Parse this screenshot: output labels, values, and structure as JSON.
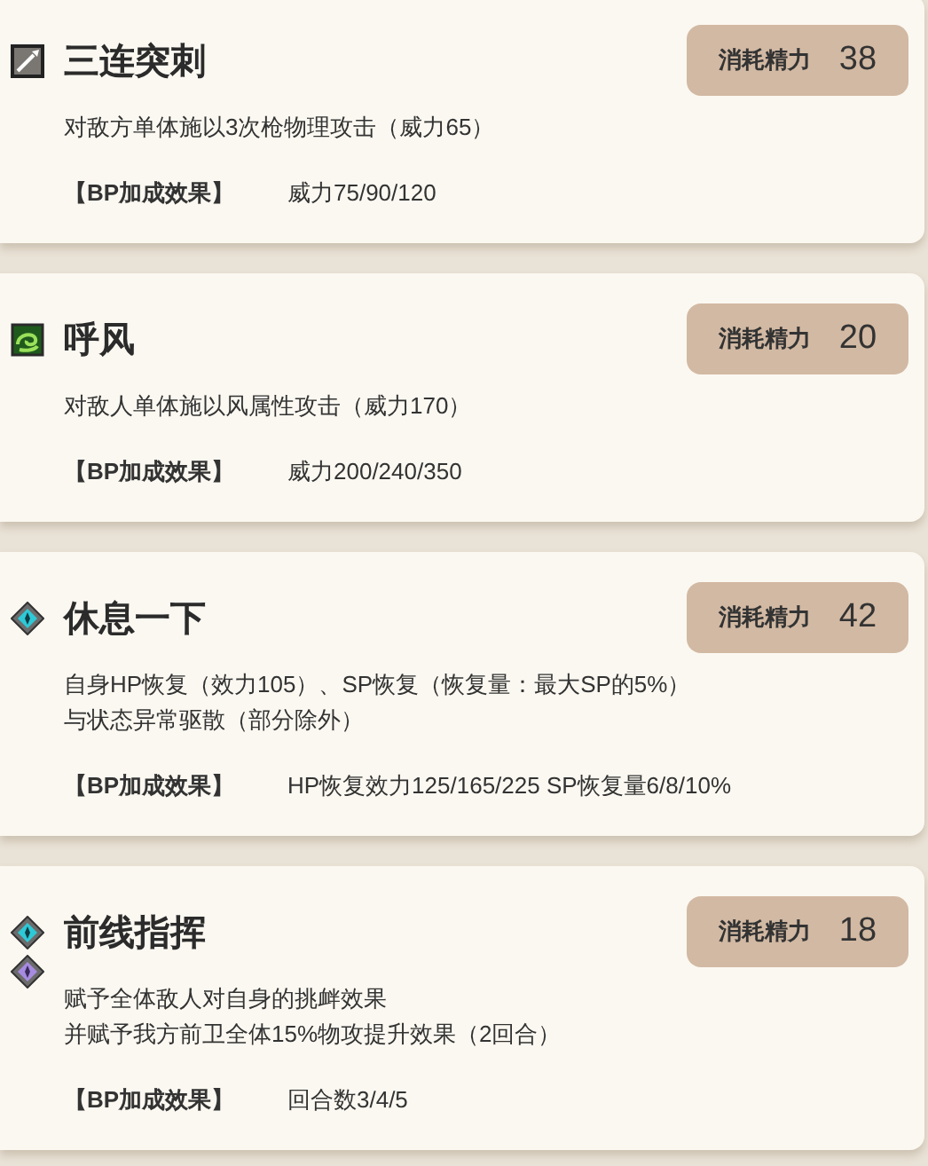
{
  "skills": [
    {
      "icons": [
        {
          "kind": "spear"
        }
      ],
      "name": "三连突刺",
      "cost_label": "消耗精力",
      "cost": "38",
      "description": [
        "对敌方单体施以3次枪物理攻击（威力65）"
      ],
      "bp_label": "【BP加成效果】",
      "bp_effect": "威力75/90/120"
    },
    {
      "icons": [
        {
          "kind": "wind"
        }
      ],
      "name": "呼风",
      "cost_label": "消耗精力",
      "cost": "20",
      "description": [
        "对敌人单体施以风属性攻击（威力170）"
      ],
      "bp_label": "【BP加成效果】",
      "bp_effect": "威力200/240/350"
    },
    {
      "icons": [
        {
          "kind": "gem-cyan"
        }
      ],
      "name": "休息一下",
      "cost_label": "消耗精力",
      "cost": "42",
      "description": [
        "自身HP恢复（效力105）、SP恢复（恢复量：最大SP的5%）",
        "与状态异常驱散（部分除外）"
      ],
      "bp_label": "【BP加成效果】",
      "bp_effect": "HP恢复效力125/165/225 SP恢复量6/8/10%"
    },
    {
      "icons": [
        {
          "kind": "gem-cyan"
        },
        {
          "kind": "gem-purple"
        }
      ],
      "name": "前线指挥",
      "cost_label": "消耗精力",
      "cost": "18",
      "description": [
        "赋予全体敌人对自身的挑衅效果",
        "并赋予我方前卫全体15%物攻提升效果（2回合）"
      ],
      "bp_label": "【BP加成效果】",
      "bp_effect": "回合数3/4/5"
    }
  ]
}
